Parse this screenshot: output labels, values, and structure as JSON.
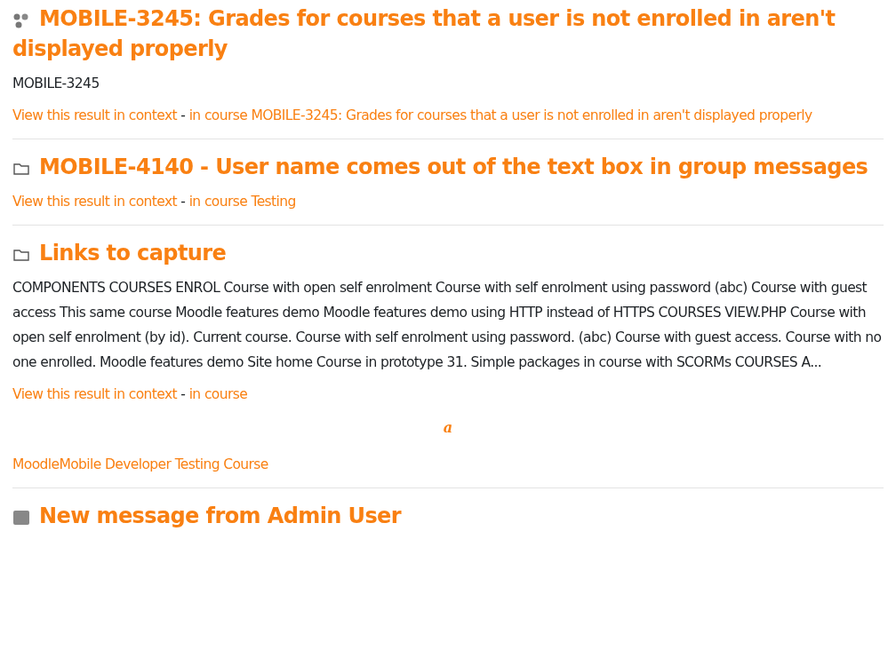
{
  "results": [
    {
      "kind": "network",
      "title": "MOBILE-3245: Grades for courses that a user is not enrolled in aren't displayed properly",
      "snippet": "MOBILE-3245",
      "context_link": "View this result in context",
      "separator": "-",
      "course_link": "in course MOBILE-3245: Grades for courses that a user is not enrolled in aren't displayed properly"
    },
    {
      "kind": "folder",
      "title": "MOBILE-4140 - User name comes out of the text box in group messages",
      "context_link": "View this result in context",
      "separator": "-",
      "course_link": "in course Testing"
    },
    {
      "kind": "folder",
      "title": "Links to capture",
      "snippet": "COMPONENTS COURSES ENROL Course with open self enrolment Course with self enrolment using password (abc) Course with guest access This same course Moodle features demo Moodle features demo using HTTP instead of HTTPS COURSES VIEW.PHP Course with open self enrolment (by id). Current course. Course with self enrolment using password. (abc) Course with guest access. Course with no one enrolled. Moodle features demo Site home Course in prototype 31. Simple packages in course with SCORMs COURSES A...",
      "context_link": "View this result in context",
      "separator": "-",
      "course_link": "in course",
      "math": "a",
      "extra_link": "MoodleMobile Developer Testing Course"
    },
    {
      "kind": "message",
      "title": "New message from Admin User"
    }
  ]
}
